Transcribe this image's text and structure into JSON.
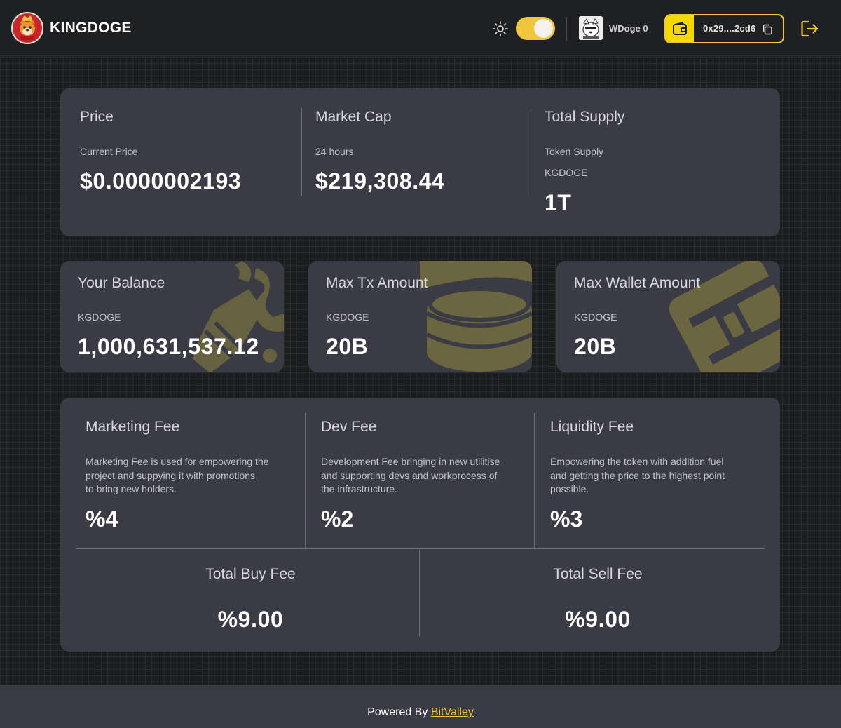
{
  "header": {
    "brand": "KINGDOGE",
    "wdoge_label": "WDoge 0",
    "wallet_address": "0x29....2cd6",
    "theme_toggle_on": true,
    "colors": {
      "accent": "#f0c63c",
      "wallet_icon_bg": "#f5d800"
    }
  },
  "stats": {
    "price": {
      "title": "Price",
      "subtitle": "Current Price",
      "value": "$0.0000002193"
    },
    "market_cap": {
      "title": "Market Cap",
      "subtitle": "24 hours",
      "value": "$219,308.44"
    },
    "total_supply": {
      "title": "Total Supply",
      "subtitle": "Token Supply",
      "unit": "KGDOGE",
      "value": "1T"
    }
  },
  "balances": [
    {
      "title": "Your Balance",
      "unit": "KGDOGE",
      "value": "1,000,631,537.12",
      "icon": "rocket-icon"
    },
    {
      "title": "Max Tx Amount",
      "unit": "KGDOGE",
      "value": "20B",
      "icon": "coins-icon"
    },
    {
      "title": "Max Wallet Amount",
      "unit": "KGDOGE",
      "value": "20B",
      "icon": "wallet-icon"
    }
  ],
  "fees": [
    {
      "title": "Marketing Fee",
      "description_lines": [
        "Marketing Fee is used for empowering the",
        "project and suppying it with promotions",
        "to bring new holders."
      ],
      "value": "%4"
    },
    {
      "title": "Dev Fee",
      "description_lines": [
        "Development Fee bringing in new utilitise",
        "and supporting devs and workprocess of",
        "the infrastructure."
      ],
      "value": "%2"
    },
    {
      "title": "Liquidity Fee",
      "description_lines": [
        "Empowering the token with addition fuel",
        "and getting the price to the highest point",
        "possible."
      ],
      "value": "%3"
    }
  ],
  "totals": {
    "buy": {
      "title": "Total Buy Fee",
      "value": "%9.00"
    },
    "sell": {
      "title": "Total Sell Fee",
      "value": "%9.00"
    }
  },
  "footer": {
    "prefix": "Powered By",
    "link_text": "BitValley"
  },
  "colors": {
    "background": "#1e1f22",
    "card": "#3a3b44",
    "accent": "#f0c63c",
    "art": "#6b6640"
  }
}
